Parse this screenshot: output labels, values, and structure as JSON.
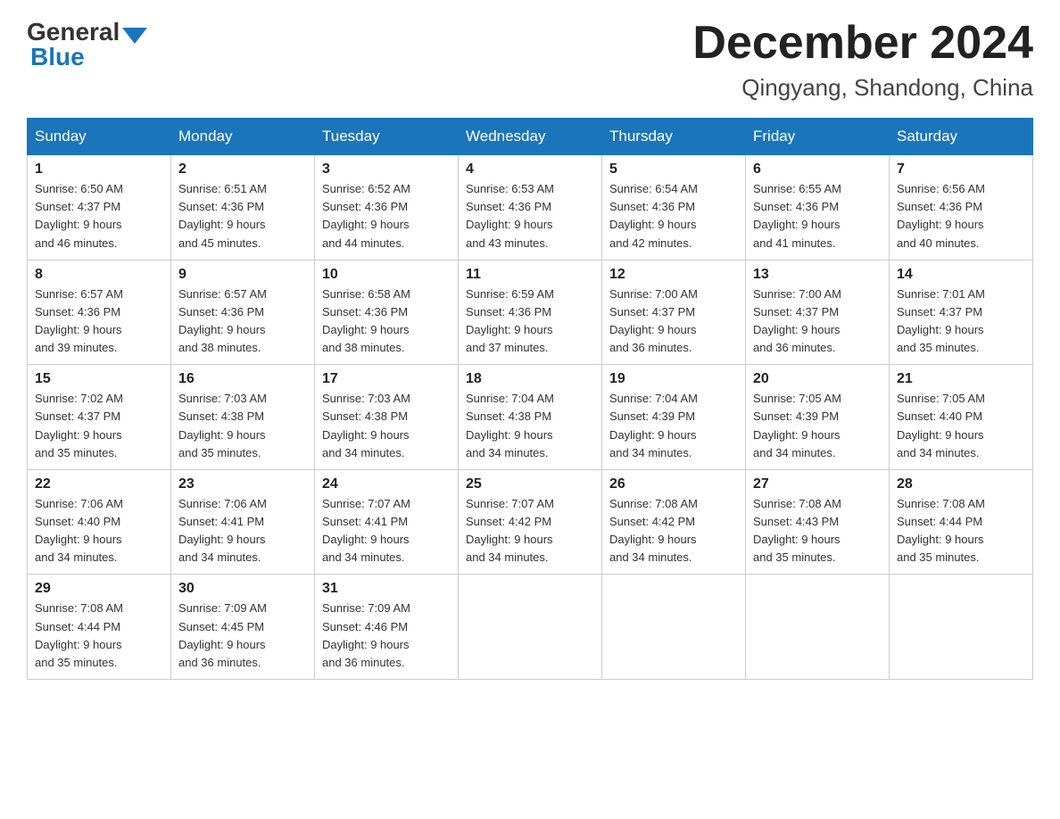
{
  "header": {
    "logo_general": "General",
    "logo_blue": "Blue",
    "month_title": "December 2024",
    "location": "Qingyang, Shandong, China"
  },
  "weekdays": [
    "Sunday",
    "Monday",
    "Tuesday",
    "Wednesday",
    "Thursday",
    "Friday",
    "Saturday"
  ],
  "weeks": [
    [
      {
        "day": "1",
        "sunrise": "6:50 AM",
        "sunset": "4:37 PM",
        "daylight": "9 hours and 46 minutes."
      },
      {
        "day": "2",
        "sunrise": "6:51 AM",
        "sunset": "4:36 PM",
        "daylight": "9 hours and 45 minutes."
      },
      {
        "day": "3",
        "sunrise": "6:52 AM",
        "sunset": "4:36 PM",
        "daylight": "9 hours and 44 minutes."
      },
      {
        "day": "4",
        "sunrise": "6:53 AM",
        "sunset": "4:36 PM",
        "daylight": "9 hours and 43 minutes."
      },
      {
        "day": "5",
        "sunrise": "6:54 AM",
        "sunset": "4:36 PM",
        "daylight": "9 hours and 42 minutes."
      },
      {
        "day": "6",
        "sunrise": "6:55 AM",
        "sunset": "4:36 PM",
        "daylight": "9 hours and 41 minutes."
      },
      {
        "day": "7",
        "sunrise": "6:56 AM",
        "sunset": "4:36 PM",
        "daylight": "9 hours and 40 minutes."
      }
    ],
    [
      {
        "day": "8",
        "sunrise": "6:57 AM",
        "sunset": "4:36 PM",
        "daylight": "9 hours and 39 minutes."
      },
      {
        "day": "9",
        "sunrise": "6:57 AM",
        "sunset": "4:36 PM",
        "daylight": "9 hours and 38 minutes."
      },
      {
        "day": "10",
        "sunrise": "6:58 AM",
        "sunset": "4:36 PM",
        "daylight": "9 hours and 38 minutes."
      },
      {
        "day": "11",
        "sunrise": "6:59 AM",
        "sunset": "4:36 PM",
        "daylight": "9 hours and 37 minutes."
      },
      {
        "day": "12",
        "sunrise": "7:00 AM",
        "sunset": "4:37 PM",
        "daylight": "9 hours and 36 minutes."
      },
      {
        "day": "13",
        "sunrise": "7:00 AM",
        "sunset": "4:37 PM",
        "daylight": "9 hours and 36 minutes."
      },
      {
        "day": "14",
        "sunrise": "7:01 AM",
        "sunset": "4:37 PM",
        "daylight": "9 hours and 35 minutes."
      }
    ],
    [
      {
        "day": "15",
        "sunrise": "7:02 AM",
        "sunset": "4:37 PM",
        "daylight": "9 hours and 35 minutes."
      },
      {
        "day": "16",
        "sunrise": "7:03 AM",
        "sunset": "4:38 PM",
        "daylight": "9 hours and 35 minutes."
      },
      {
        "day": "17",
        "sunrise": "7:03 AM",
        "sunset": "4:38 PM",
        "daylight": "9 hours and 34 minutes."
      },
      {
        "day": "18",
        "sunrise": "7:04 AM",
        "sunset": "4:38 PM",
        "daylight": "9 hours and 34 minutes."
      },
      {
        "day": "19",
        "sunrise": "7:04 AM",
        "sunset": "4:39 PM",
        "daylight": "9 hours and 34 minutes."
      },
      {
        "day": "20",
        "sunrise": "7:05 AM",
        "sunset": "4:39 PM",
        "daylight": "9 hours and 34 minutes."
      },
      {
        "day": "21",
        "sunrise": "7:05 AM",
        "sunset": "4:40 PM",
        "daylight": "9 hours and 34 minutes."
      }
    ],
    [
      {
        "day": "22",
        "sunrise": "7:06 AM",
        "sunset": "4:40 PM",
        "daylight": "9 hours and 34 minutes."
      },
      {
        "day": "23",
        "sunrise": "7:06 AM",
        "sunset": "4:41 PM",
        "daylight": "9 hours and 34 minutes."
      },
      {
        "day": "24",
        "sunrise": "7:07 AM",
        "sunset": "4:41 PM",
        "daylight": "9 hours and 34 minutes."
      },
      {
        "day": "25",
        "sunrise": "7:07 AM",
        "sunset": "4:42 PM",
        "daylight": "9 hours and 34 minutes."
      },
      {
        "day": "26",
        "sunrise": "7:08 AM",
        "sunset": "4:42 PM",
        "daylight": "9 hours and 34 minutes."
      },
      {
        "day": "27",
        "sunrise": "7:08 AM",
        "sunset": "4:43 PM",
        "daylight": "9 hours and 35 minutes."
      },
      {
        "day": "28",
        "sunrise": "7:08 AM",
        "sunset": "4:44 PM",
        "daylight": "9 hours and 35 minutes."
      }
    ],
    [
      {
        "day": "29",
        "sunrise": "7:08 AM",
        "sunset": "4:44 PM",
        "daylight": "9 hours and 35 minutes."
      },
      {
        "day": "30",
        "sunrise": "7:09 AM",
        "sunset": "4:45 PM",
        "daylight": "9 hours and 36 minutes."
      },
      {
        "day": "31",
        "sunrise": "7:09 AM",
        "sunset": "4:46 PM",
        "daylight": "9 hours and 36 minutes."
      },
      null,
      null,
      null,
      null
    ]
  ],
  "labels": {
    "sunrise": "Sunrise:",
    "sunset": "Sunset:",
    "daylight": "Daylight:"
  }
}
